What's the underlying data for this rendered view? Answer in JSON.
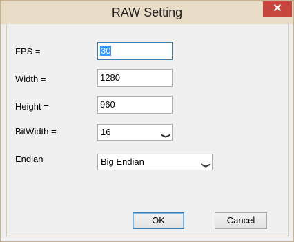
{
  "window": {
    "title": "RAW Setting",
    "close_glyph": "✕"
  },
  "fields": {
    "fps": {
      "label": "FPS =",
      "value": "30"
    },
    "width": {
      "label": "Width =",
      "value": "1280"
    },
    "height": {
      "label": "Height =",
      "value": "960"
    },
    "bitwidth": {
      "label": "BitWidth =",
      "value": "16"
    },
    "endian": {
      "label": "Endian",
      "value": "Big Endian"
    }
  },
  "buttons": {
    "ok": "OK",
    "cancel": "Cancel"
  },
  "icons": {
    "chevron": "chevron-down-icon",
    "close": "close-icon"
  },
  "colors": {
    "titlebar": "#e9dcc6",
    "close": "#c7463e",
    "selection": "#3399ff",
    "focus_border": "#3c7fb1"
  }
}
